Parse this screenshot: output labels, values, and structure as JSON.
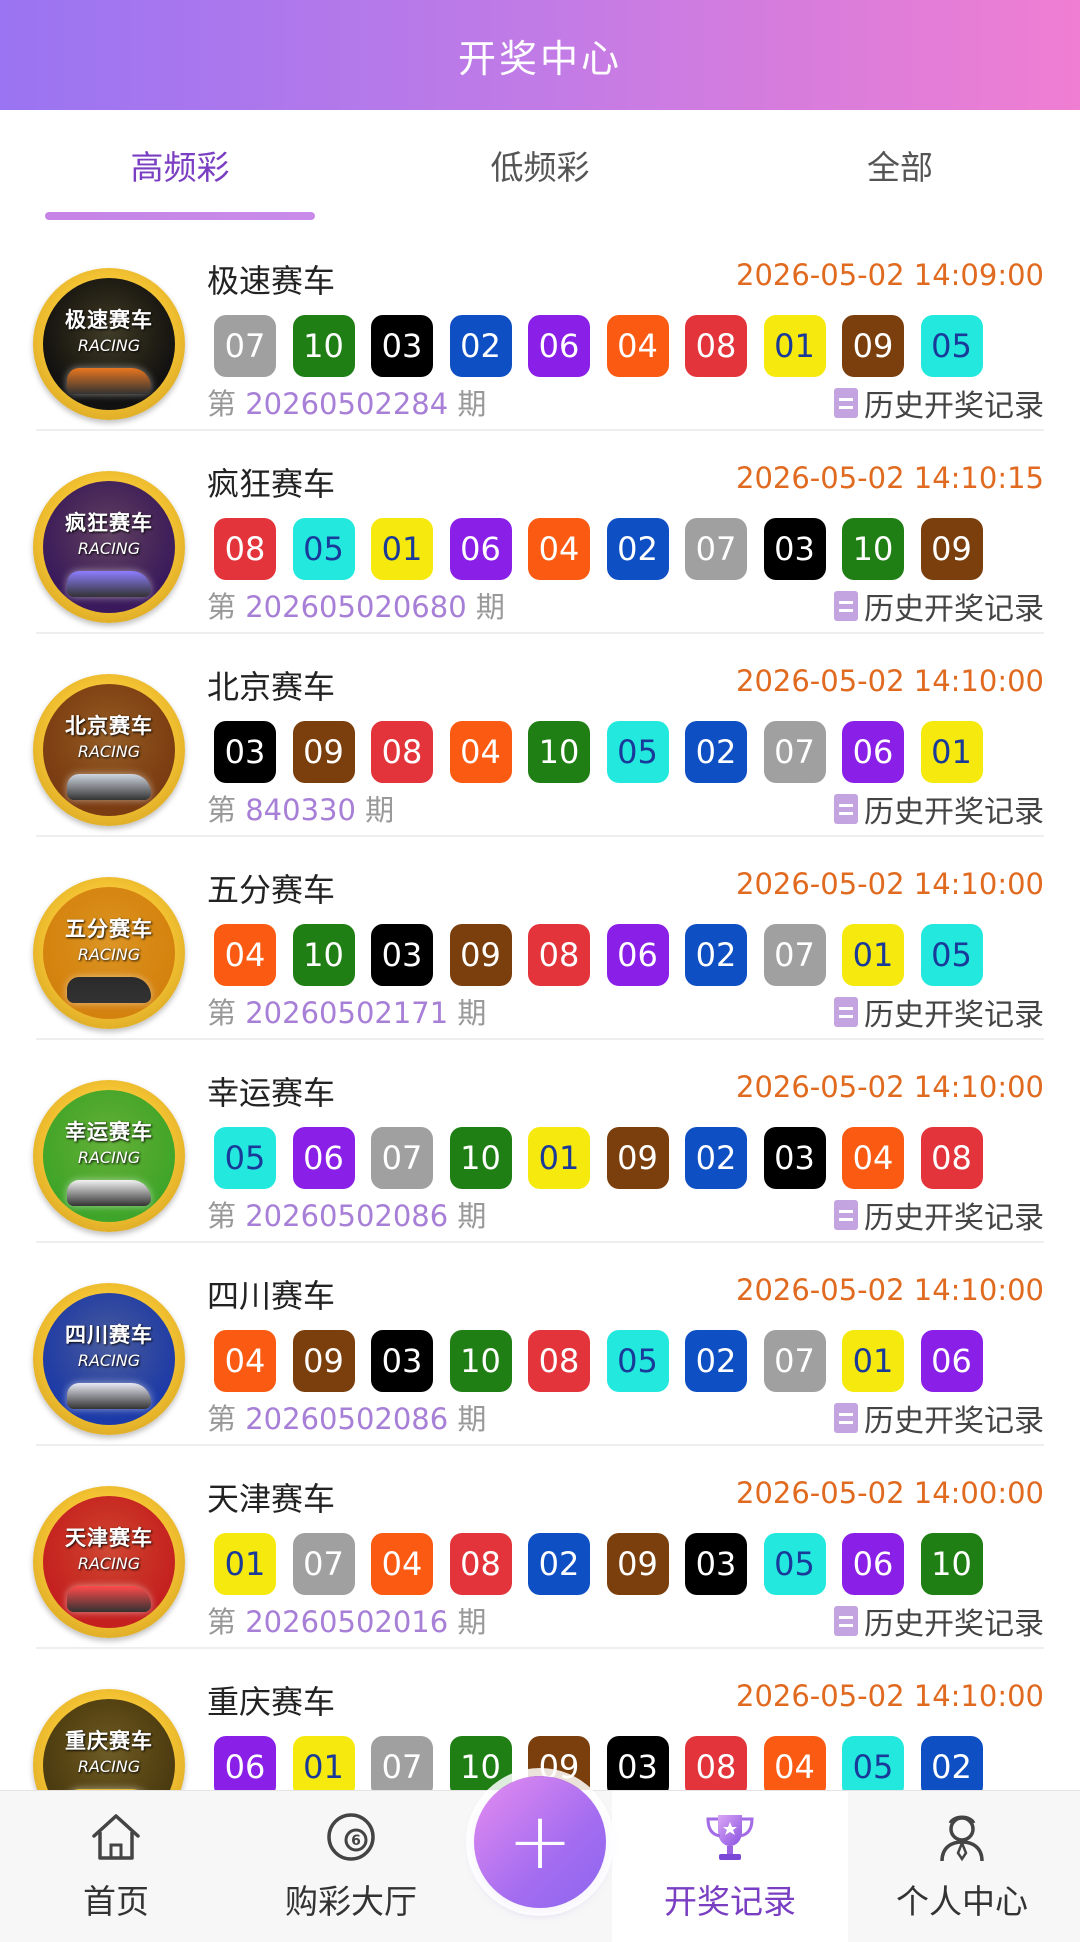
{
  "header": {
    "title": "开奖中心"
  },
  "tabs": [
    {
      "label": "高频彩",
      "active": true
    },
    {
      "label": "低频彩",
      "active": false
    },
    {
      "label": "全部",
      "active": false
    }
  ],
  "ball_colors": {
    "01": "#f5e90d",
    "02": "#0f4fc4",
    "03": "#000000",
    "04": "#fa5a12",
    "05": "#22e8dd",
    "06": "#8a1fe8",
    "07": "#a0a0a0",
    "08": "#e3343b",
    "09": "#7a3f0c",
    "10": "#1f7f14"
  },
  "colors": {
    "accent": "#7a3ec2",
    "time": "#e06a1f",
    "issue_number": "#a77fd6"
  },
  "history_label": "历史开奖记录",
  "issue_prefix": "第",
  "issue_suffix": "期",
  "logo_sub": "RACING",
  "items": [
    {
      "logo_name": "极速赛车",
      "logo_bg": "#111111",
      "car_color": "#e8761e",
      "name": "极速赛车",
      "time": "2026-05-02 14:09:00",
      "issue": "20260502284",
      "balls": [
        "07",
        "10",
        "03",
        "02",
        "06",
        "04",
        "08",
        "01",
        "09",
        "05"
      ]
    },
    {
      "logo_name": "疯狂赛车",
      "logo_bg": "#3a1a5c",
      "car_color": "#8c7dff",
      "name": "疯狂赛车",
      "time": "2026-05-02 14:10:15",
      "issue": "202605020680",
      "balls": [
        "08",
        "05",
        "01",
        "06",
        "04",
        "02",
        "07",
        "03",
        "10",
        "09"
      ]
    },
    {
      "logo_name": "北京赛车",
      "logo_bg": "#7a3c12",
      "car_color": "#cfd6e0",
      "name": "北京赛车",
      "time": "2026-05-02 14:10:00",
      "issue": "840330",
      "balls": [
        "03",
        "09",
        "08",
        "04",
        "10",
        "05",
        "02",
        "07",
        "06",
        "01"
      ]
    },
    {
      "logo_name": "五分赛车",
      "logo_bg": "#d4820f",
      "car_color": "#2a2a2a",
      "name": "五分赛车",
      "time": "2026-05-02 14:10:00",
      "issue": "20260502171",
      "balls": [
        "04",
        "10",
        "03",
        "09",
        "08",
        "06",
        "02",
        "07",
        "01",
        "05"
      ]
    },
    {
      "logo_name": "幸运赛车",
      "logo_bg": "#3fa52a",
      "car_color": "#f2f2f2",
      "name": "幸运赛车",
      "time": "2026-05-02 14:10:00",
      "issue": "20260502086",
      "balls": [
        "05",
        "06",
        "07",
        "10",
        "01",
        "09",
        "02",
        "03",
        "04",
        "08"
      ]
    },
    {
      "logo_name": "四川赛车",
      "logo_bg": "#1d3ba8",
      "car_color": "#e8e8f4",
      "name": "四川赛车",
      "time": "2026-05-02 14:10:00",
      "issue": "20260502086",
      "balls": [
        "04",
        "09",
        "03",
        "10",
        "08",
        "05",
        "02",
        "07",
        "01",
        "06"
      ]
    },
    {
      "logo_name": "天津赛车",
      "logo_bg": "#c42020",
      "car_color": "#ff4a4a",
      "name": "天津赛车",
      "time": "2026-05-02 14:00:00",
      "issue": "20260502016",
      "balls": [
        "01",
        "07",
        "04",
        "08",
        "02",
        "09",
        "03",
        "05",
        "06",
        "10"
      ]
    },
    {
      "logo_name": "重庆赛车",
      "logo_bg": "#4a3a10",
      "car_color": "#e6c23a",
      "name": "重庆赛车",
      "time": "2026-05-02 14:10:00",
      "issue": "",
      "balls": [
        "06",
        "01",
        "07",
        "10",
        "09",
        "03",
        "08",
        "04",
        "05",
        "02"
      ]
    }
  ],
  "tabbar": [
    {
      "label": "首页",
      "icon": "home-icon",
      "active": false
    },
    {
      "label": "购彩大厅",
      "icon": "lottery-hall-icon",
      "active": false
    },
    {
      "label": "开奖记录",
      "icon": "trophy-icon",
      "active": true
    },
    {
      "label": "个人中心",
      "icon": "user-icon",
      "active": false
    }
  ],
  "plus_button": {
    "icon": "plus-icon"
  }
}
